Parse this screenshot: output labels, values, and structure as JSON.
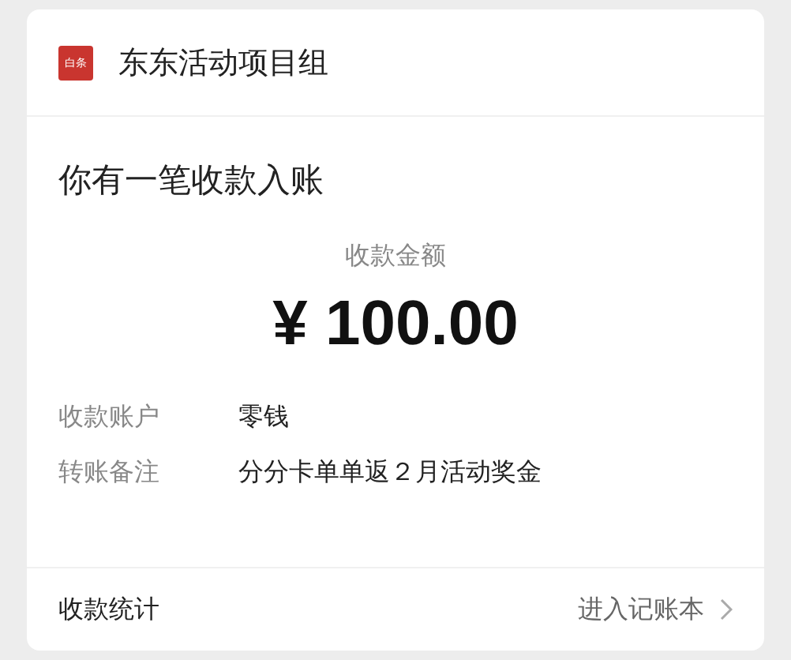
{
  "header": {
    "icon_text": "白条",
    "title": "东东活动项目组"
  },
  "message": "你有一笔收款入账",
  "amount": {
    "label": "收款金额",
    "value": "¥ 100.00"
  },
  "details": [
    {
      "label": "收款账户",
      "value": "零钱"
    },
    {
      "label": "转账备注",
      "value": "分分卡单单返２月活动奖金"
    }
  ],
  "footer": {
    "left": "收款统计",
    "link": "进入记账本"
  }
}
